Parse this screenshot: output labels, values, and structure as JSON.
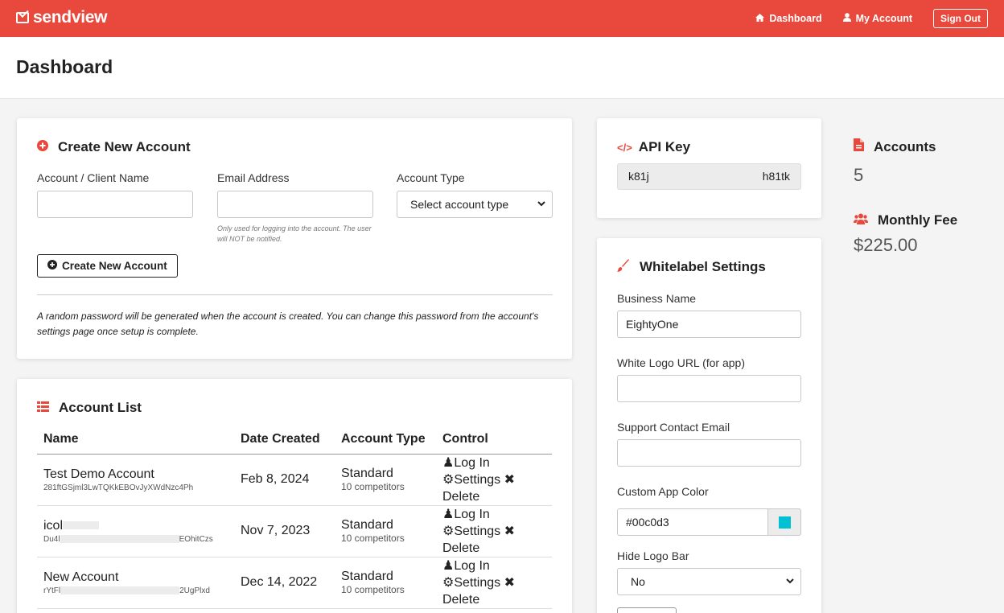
{
  "app": {
    "brand": "sendview",
    "nav": {
      "dashboard": "Dashboard",
      "my_account": "My Account",
      "sign_out": "Sign Out"
    },
    "page_title": "Dashboard"
  },
  "create_account": {
    "title": "Create New Account",
    "name_label": "Account / Client Name",
    "name_value": "",
    "email_label": "Email Address",
    "email_value": "",
    "email_hint": "Only used for logging into the account. The user will NOT be notified.",
    "type_label": "Account Type",
    "type_selected": "Select account type",
    "button_label": "Create New Account",
    "note": "A random password will be generated when the account is created. You can change this password from the account's settings page once setup is complete."
  },
  "account_list": {
    "title": "Account List",
    "columns": [
      "Name",
      "Date Created",
      "Account Type",
      "Control"
    ],
    "rows": [
      {
        "name": "Test Demo Account",
        "id": "281ftGSjml3LwTQKkEBOvJyXWdNzc4Ph",
        "date": "Feb 8, 2024",
        "type": "Standard",
        "competitors": "10 competitors"
      },
      {
        "name": "icol",
        "id_start": "Du4l",
        "id_end": "EOhitCzs",
        "date": "Nov 7, 2023",
        "type": "Standard",
        "competitors": "10 competitors"
      },
      {
        "name": "New Account",
        "id_start": "rYtFl",
        "id_end": "2UgPlxd",
        "date": "Dec 14, 2022",
        "type": "Standard",
        "competitors": "10 competitors"
      }
    ],
    "controls": {
      "login": "Log In",
      "settings": "Settings",
      "delete": "Delete"
    }
  },
  "api_key": {
    "title": "API Key",
    "value_start": "k81j",
    "value_end": "h81tk"
  },
  "whitelabel": {
    "title": "Whitelabel Settings",
    "business_name_label": "Business Name",
    "business_name_value": "EightyOne",
    "logo_url_label": "White Logo URL (for app)",
    "logo_url_value": "",
    "support_email_label": "Support Contact Email",
    "support_email_value": "",
    "app_color_label": "Custom App Color",
    "app_color_value": "#00c0d3",
    "hide_logo_label": "Hide Logo Bar",
    "hide_logo_value": "No"
  },
  "stats": {
    "accounts_label": "Accounts",
    "accounts_value": "5",
    "fee_label": "Monthly Fee",
    "fee_value": "$225.00"
  },
  "colors": {
    "accent": "#e8493c",
    "swatch": "#00c0d3"
  },
  "icons": [
    "logo-icon",
    "home-icon",
    "user-icon",
    "plus-circle-icon",
    "code-icon",
    "list-icon",
    "brush-icon",
    "file-icon",
    "users-icon",
    "chevron-down-icon",
    "gear-icon",
    "times-icon"
  ]
}
